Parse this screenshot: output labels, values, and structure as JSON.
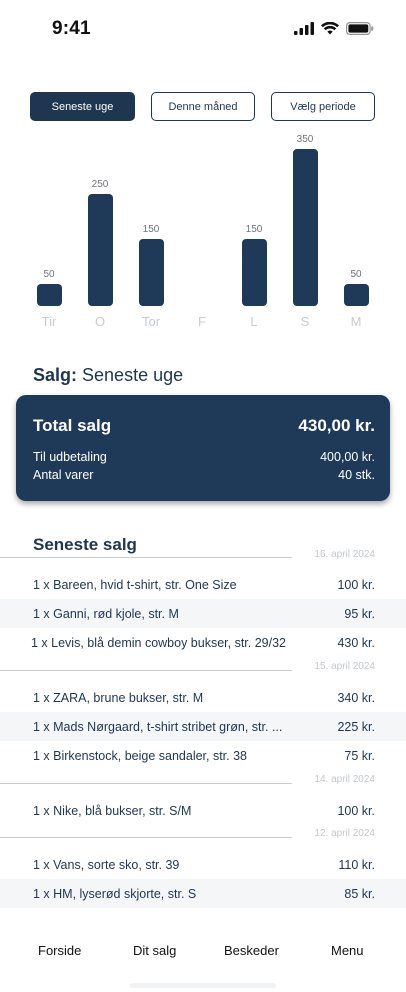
{
  "status_bar": {
    "time": "9:41"
  },
  "filters": [
    {
      "label": "Seneste uge",
      "active": true
    },
    {
      "label": "Denne måned",
      "active": false
    },
    {
      "label": "Vælg periode",
      "active": false
    }
  ],
  "chart_data": {
    "type": "bar",
    "categories": [
      "Tir",
      "O",
      "Tor",
      "F",
      "L",
      "S",
      "M"
    ],
    "values": [
      50,
      250,
      150,
      0,
      150,
      350,
      50
    ],
    "value_labels": [
      "50",
      "250",
      "150",
      "",
      "150",
      "350",
      "50"
    ],
    "title": "",
    "xlabel": "",
    "ylabel": "",
    "ylim": [
      0,
      350
    ],
    "grid": false
  },
  "sales_header": {
    "prefix": "Salg:",
    "period": "Seneste uge"
  },
  "summary": {
    "total_label": "Total salg",
    "total_value": "430,00 kr.",
    "payout_label": "Til udbetaling",
    "payout_value": "400,00 kr.",
    "items_label": "Antal varer",
    "items_value": "40 stk."
  },
  "recent": {
    "title": "Seneste salg",
    "groups": [
      {
        "date": "16. april 2024",
        "rows": [
          {
            "item": "1 x Bareen, hvid t-shirt, str. One Size",
            "price": "100 kr."
          },
          {
            "item": "1 x Ganni, rød kjole, str. M",
            "price": "95 kr."
          },
          {
            "item": "1 x Levis, blå demin cowboy bukser, str. 29/32",
            "price": "430 kr."
          }
        ]
      },
      {
        "date": "15. april 2024",
        "rows": [
          {
            "item": "1 x ZARA, brune bukser, str. M",
            "price": "340 kr."
          },
          {
            "item": "1 x Mads Nørgaard, t-shirt stribet grøn, str. ...",
            "price": "225 kr."
          },
          {
            "item": "1 x Birkenstock, beige sandaler, str. 38",
            "price": "75 kr."
          }
        ]
      },
      {
        "date": "14. april 2024",
        "rows": [
          {
            "item": "1 x Nike, blå bukser, str. S/M",
            "price": "100 kr."
          }
        ]
      },
      {
        "date": "12. april 2024",
        "rows": [
          {
            "item": "1 x Vans, sorte sko, str. 39",
            "price": "110 kr."
          },
          {
            "item": "1 x HM, lyserød skjorte, str. S",
            "price": "85 kr."
          }
        ]
      }
    ]
  },
  "nav": {
    "home": "Forside",
    "sales": "Dit salg",
    "messages": "Beskeder",
    "menu": "Menu"
  },
  "colors": {
    "primary": "#1f3a58",
    "muted": "#c4c8cd",
    "row_alt": "#f4f6f8"
  }
}
